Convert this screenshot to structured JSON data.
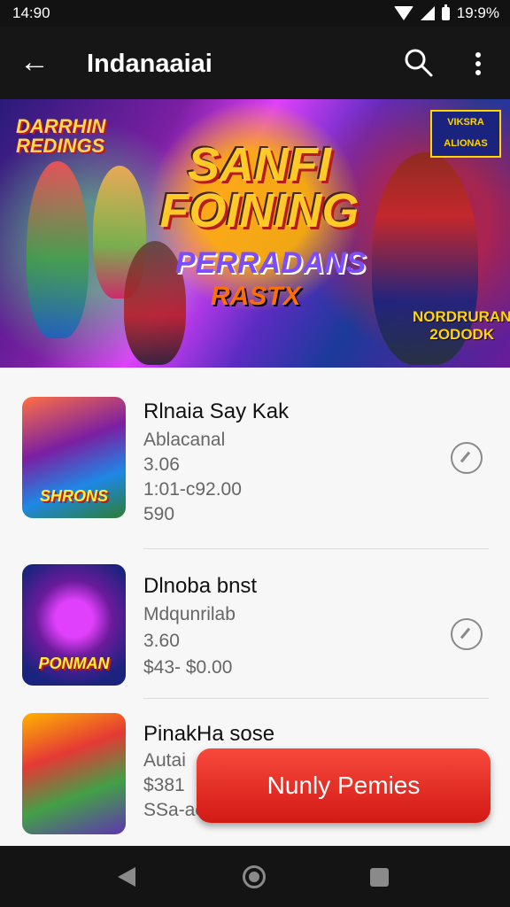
{
  "status_bar": {
    "time": "14:90",
    "battery_text": "19:9%"
  },
  "app_bar": {
    "title": "Indanaaiai"
  },
  "banner": {
    "corner_logo": "DARRHIN\nREDINGS",
    "title": "SANFI FOINING",
    "subtitle": "PERRADANS",
    "tagline": "RASTX",
    "badge": "VIKSRA\nALIONAS",
    "corner_text": "NORDRURAN\n2ODODK",
    "dots": 3,
    "active_dot": 1
  },
  "items": [
    {
      "name": "Rlnaia Say Kak",
      "developer": "Ablacanal",
      "rating": "3.06",
      "downloads": "1:01-c92.00",
      "price": "590",
      "thumb_label": "SHRONS"
    },
    {
      "name": "Dlnoba bnst",
      "developer": "Mdqunrilab",
      "rating": "3.60",
      "price": "$43- $0.00",
      "thumb_label": "PONMAN"
    },
    {
      "name": "PinakHa sose",
      "developer": "Autai",
      "rating": "$381",
      "price": "SSa-aon",
      "thumb_label": ""
    }
  ],
  "cta": {
    "label": "Nunly Pemies"
  },
  "colors": {
    "accent": "#e0271f",
    "appbar": "#161616"
  }
}
